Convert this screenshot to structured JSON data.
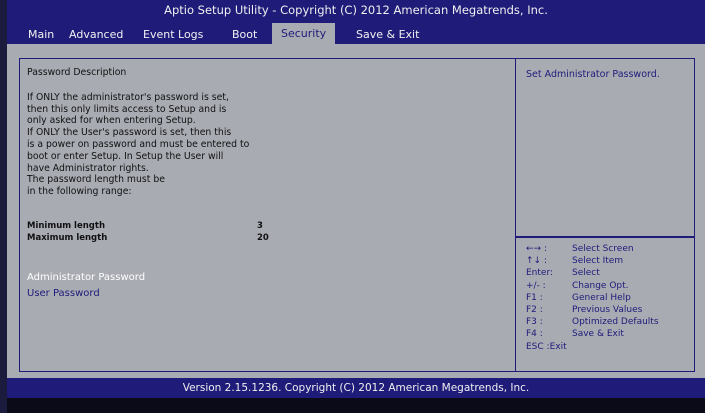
{
  "title": "Aptio Setup Utility - Copyright (C) 2012 American Megatrends, Inc.",
  "tabs": [
    {
      "label": "Main"
    },
    {
      "label": "Advanced"
    },
    {
      "label": "Event Logs"
    },
    {
      "label": "Boot"
    },
    {
      "label": "Security"
    },
    {
      "label": "Save & Exit"
    }
  ],
  "active_tab": "Security",
  "description": {
    "title": "Password Description",
    "lines": [
      "If ONLY the administrator's password is set,",
      "then this only limits access to Setup and is",
      "only asked for when entering Setup.",
      "If ONLY the User's password is set, then this",
      "is a power on password and must be entered to",
      "boot or enter Setup.  In Setup the User will",
      "have Administrator rights.",
      "The password length must be",
      "in the following range:"
    ]
  },
  "range": {
    "min_label": "Minimum length",
    "min_value": "3",
    "max_label": "Maximum length",
    "max_value": "20"
  },
  "items": {
    "admin": "Administrator Password",
    "user": "User Password"
  },
  "help_text": "Set Administrator Password.",
  "keys": [
    {
      "key": "←→ :",
      "desc": "Select Screen"
    },
    {
      "key": "↑↓  :",
      "desc": "Select Item"
    },
    {
      "key": "Enter:",
      "desc": "Select"
    },
    {
      "key": "+/- :",
      "desc": "Change Opt."
    },
    {
      "key": "F1 :",
      "desc": "General Help"
    },
    {
      "key": "F2 :",
      "desc": "Previous Values"
    },
    {
      "key": "F3 :",
      "desc": "Optimized Defaults"
    },
    {
      "key": "F4 :",
      "desc": "Save & Exit"
    },
    {
      "key": "ESC :Exit",
      "desc": ""
    }
  ],
  "footer": "Version 2.15.1236. Copyright (C) 2012 American Megatrends, Inc.",
  "colors": {
    "header_bg": "#1e1b79",
    "content_bg": "#a9abb3",
    "selected_text": "#ffffff",
    "accent_text": "#1e1b79"
  }
}
